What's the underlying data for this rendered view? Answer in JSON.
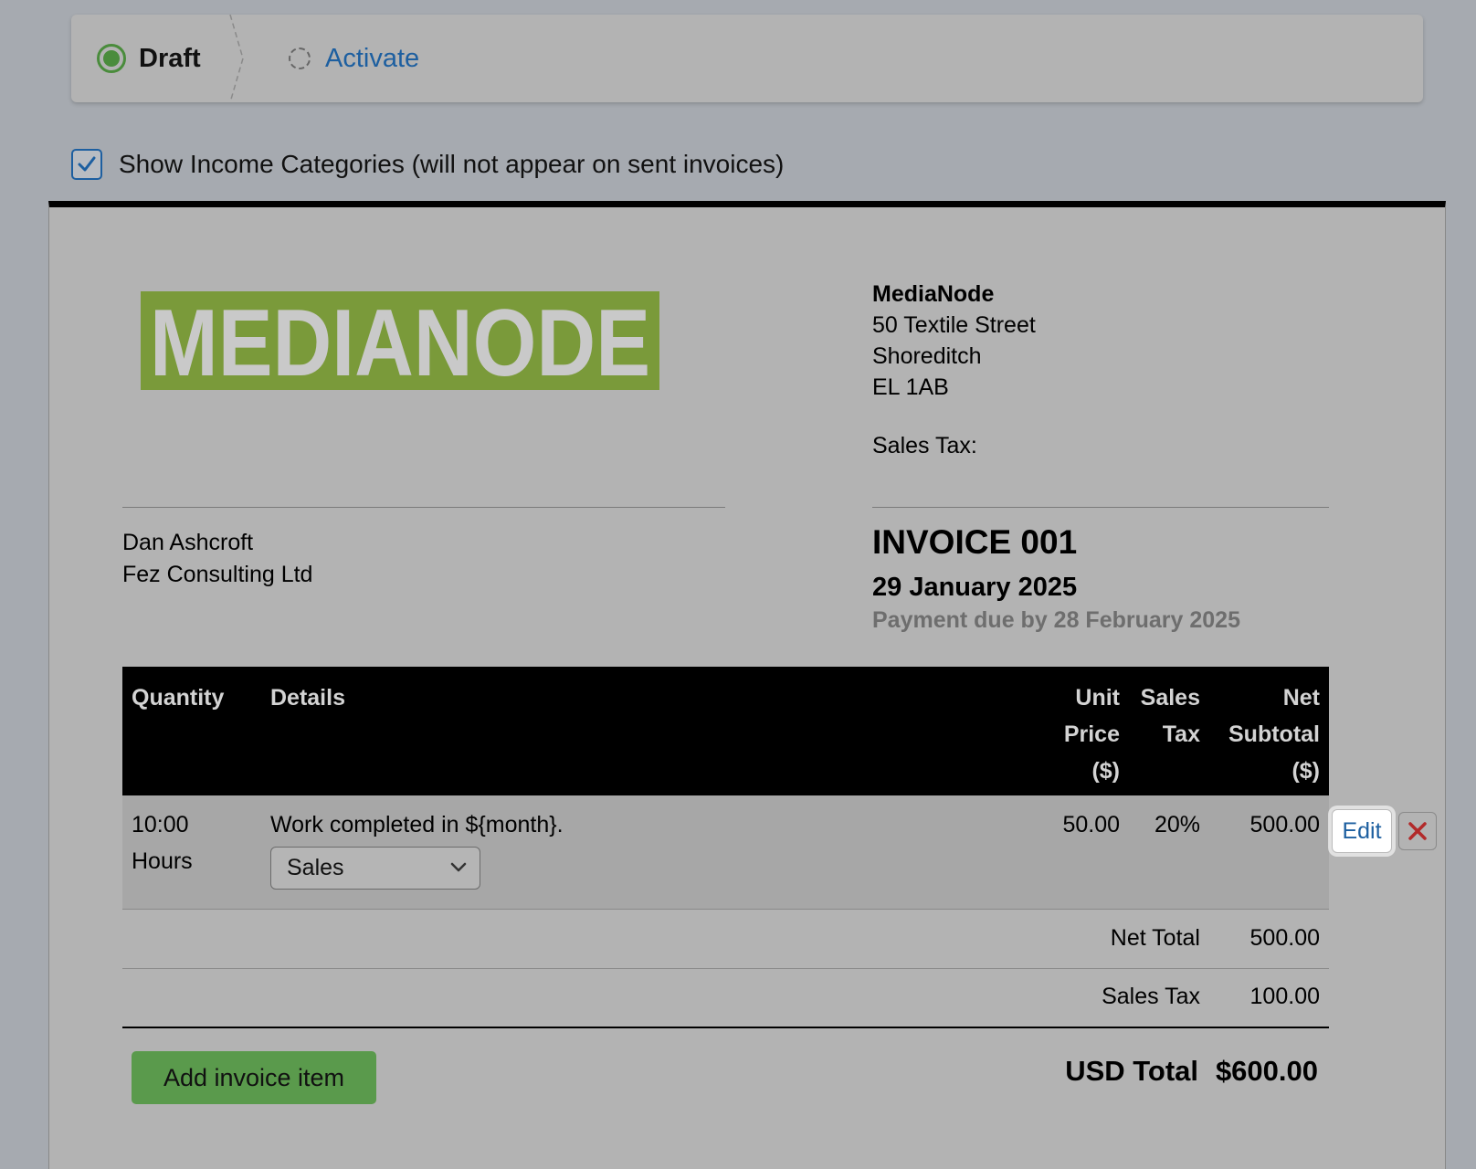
{
  "stepper": {
    "steps": [
      {
        "label": "Draft",
        "state": "active"
      },
      {
        "label": "Activate",
        "state": "pending"
      }
    ]
  },
  "categories": {
    "label": "Show Income Categories (will not appear on sent invoices)",
    "checked": true
  },
  "invoice": {
    "logo_text": "MEDIANODE",
    "from": {
      "name": "MediaNode",
      "street": "50 Textile Street",
      "district": "Shoreditch",
      "postcode": "EL 1AB",
      "sales_tax_label": "Sales Tax:"
    },
    "to": {
      "name": "Dan Ashcroft",
      "company": "Fez Consulting Ltd"
    },
    "title": "INVOICE 001",
    "date": "29 January 2025",
    "due": "Payment due by 28 February 2025",
    "table": {
      "headers": {
        "quantity": "Quantity",
        "details": "Details",
        "unit_price": [
          "Unit",
          "Price",
          "($)"
        ],
        "sales_tax": [
          "Sales",
          "Tax"
        ],
        "net_subtotal": [
          "Net",
          "Subtotal",
          "($)"
        ]
      },
      "items": [
        {
          "quantity": "10:00",
          "unit": "Hours",
          "details": "Work completed in ${month}.",
          "category": "Sales",
          "unit_price": "50.00",
          "sales_tax": "20%",
          "net_subtotal": "500.00",
          "edit_label": "Edit"
        }
      ]
    },
    "totals": {
      "net_label": "Net Total",
      "net_value": "500.00",
      "tax_label": "Sales Tax",
      "tax_value": "100.00",
      "grand_label": "USD Total",
      "grand_value": "$600.00"
    },
    "add_item_label": "Add invoice item"
  },
  "colors": {
    "accent_green": "#4a8c3c",
    "link_blue": "#1d5fa0",
    "logo_green": "#7a9a3a",
    "delete_red": "#b22a2a"
  },
  "icons": {
    "draft": "radio-active-icon",
    "activate": "radio-pending-icon",
    "checkbox": "checkmark-icon",
    "select": "chevron-down-icon",
    "delete": "close-icon"
  }
}
